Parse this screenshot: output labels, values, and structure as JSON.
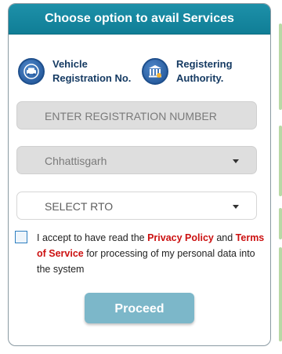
{
  "header": {
    "title": "Choose option to avail Services"
  },
  "options": [
    {
      "label_line1": "Vehicle",
      "label_line2": "Registration No.",
      "icon": "vehicle-registration-icon"
    },
    {
      "label_line1": "Registering",
      "label_line2": "Authority.",
      "icon": "government-building-icon"
    }
  ],
  "form": {
    "registration_placeholder": "ENTER REGISTRATION NUMBER",
    "state_selected": "Chhattisgarh",
    "rto_selected": "SELECT RTO"
  },
  "consent": {
    "text_part1": "I accept to have read the ",
    "privacy_link": "Privacy Policy",
    "text_part2": " and ",
    "terms_link": "Terms of Service",
    "text_part3": " for processing of my personal data into the system",
    "checked": false
  },
  "actions": {
    "proceed_label": "Proceed"
  },
  "colors": {
    "header_bg": "#1a8aa3",
    "option_text": "#163b63",
    "link": "#cc1111",
    "proceed_bg": "#7cb7c9"
  }
}
